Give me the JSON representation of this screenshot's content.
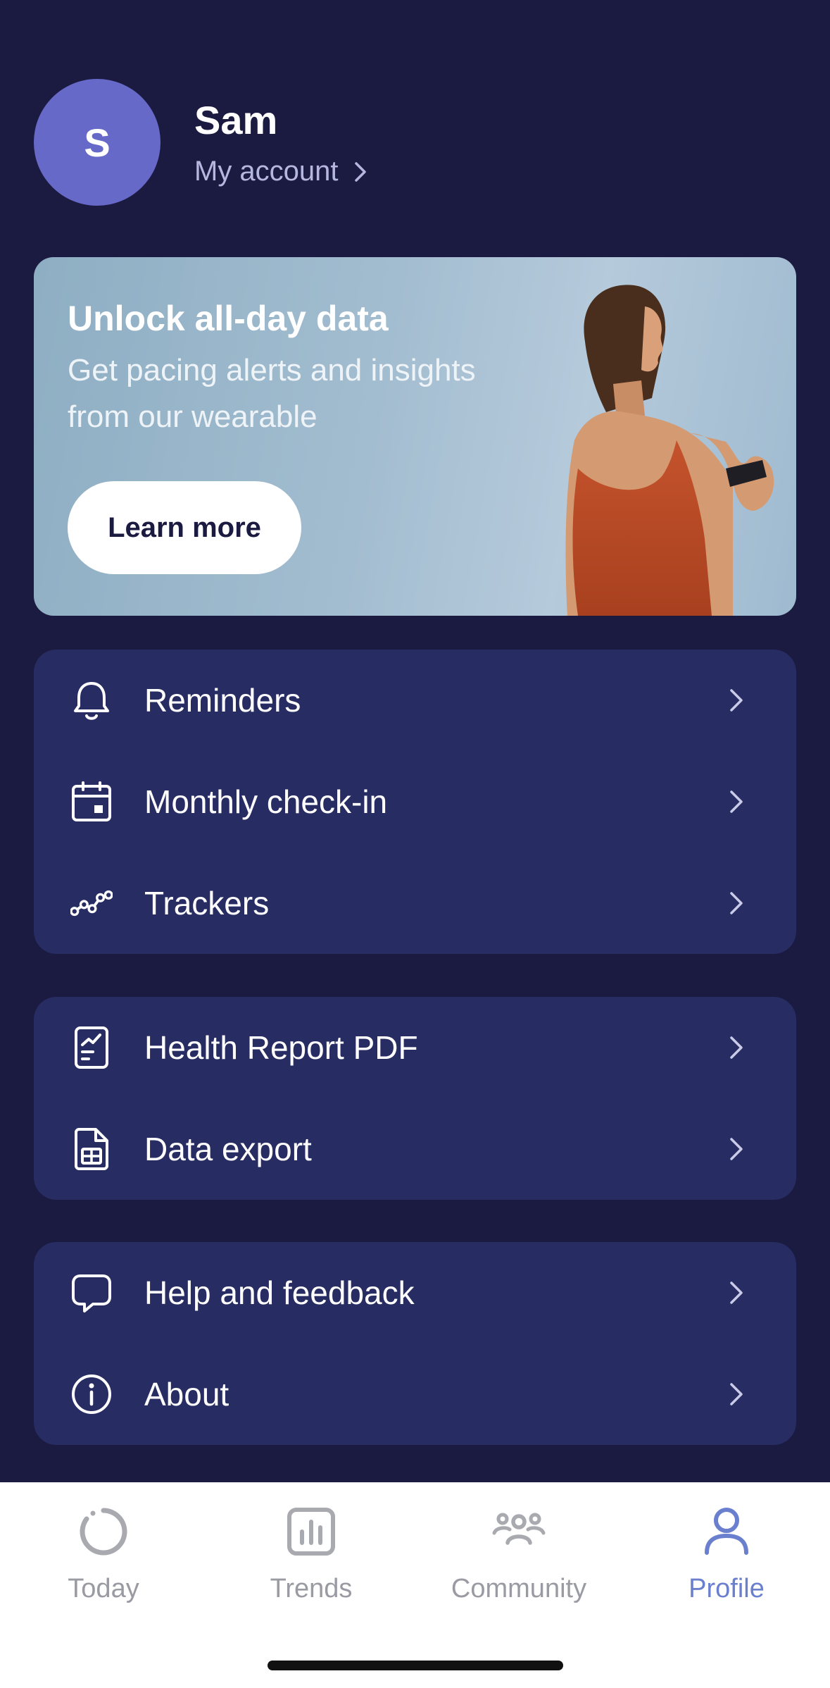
{
  "profile": {
    "avatar_initial": "S",
    "name": "Sam",
    "account_link": "My account"
  },
  "promo": {
    "title": "Unlock all-day data",
    "subtitle": "Get pacing alerts and insights from our wearable",
    "button_label": "Learn more"
  },
  "menu_groups": [
    {
      "items": [
        {
          "icon": "bell-icon",
          "label": "Reminders"
        },
        {
          "icon": "calendar-icon",
          "label": "Monthly check-in"
        },
        {
          "icon": "trend-line-icon",
          "label": "Trackers"
        }
      ]
    },
    {
      "items": [
        {
          "icon": "report-icon",
          "label": "Health Report PDF"
        },
        {
          "icon": "spreadsheet-file-icon",
          "label": "Data export"
        }
      ]
    },
    {
      "items": [
        {
          "icon": "chat-bubble-icon",
          "label": "Help and feedback"
        },
        {
          "icon": "info-icon",
          "label": "About"
        }
      ]
    }
  ],
  "tabbar": {
    "tabs": [
      {
        "label": "Today",
        "icon": "ring-icon",
        "active": false
      },
      {
        "label": "Trends",
        "icon": "bar-chart-icon",
        "active": false
      },
      {
        "label": "Community",
        "icon": "people-icon",
        "active": false
      },
      {
        "label": "Profile",
        "icon": "person-icon",
        "active": true
      }
    ]
  },
  "colors": {
    "background": "#1b1a40",
    "card": "#272c62",
    "avatar": "#6769c9",
    "tab_active": "#6b7fcf",
    "tab_inactive": "#9a9aa3"
  }
}
